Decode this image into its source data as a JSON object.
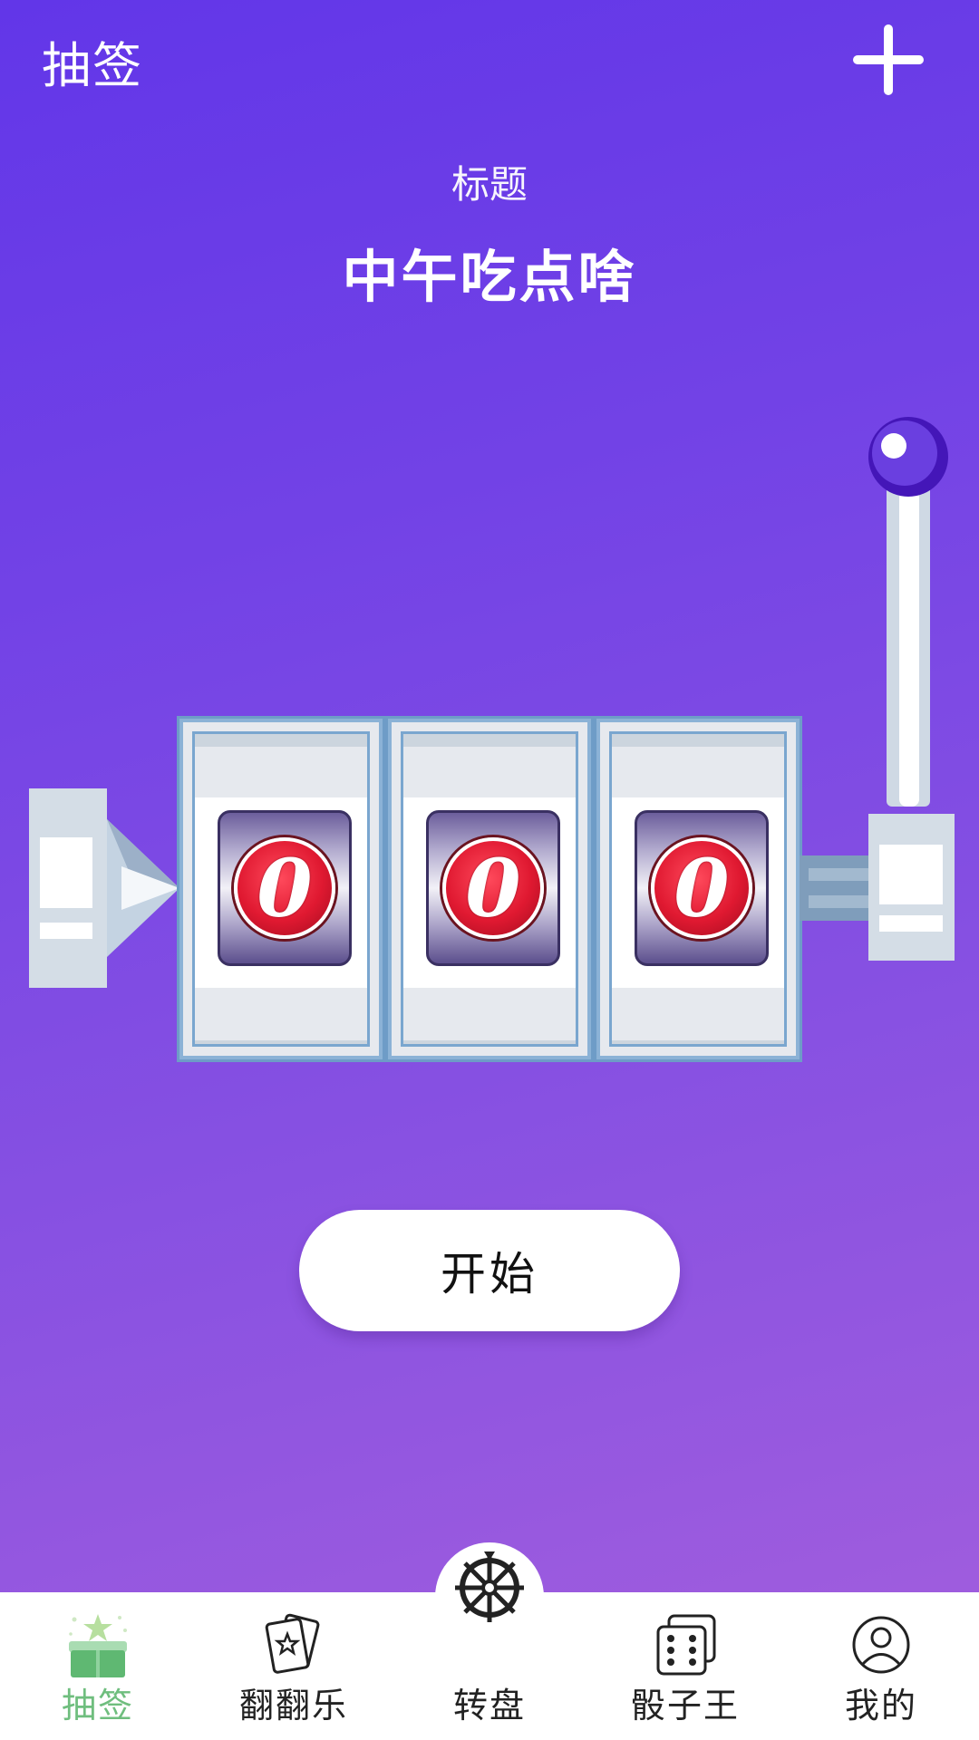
{
  "header": {
    "app_title": "抽签",
    "add_icon": "plus-icon"
  },
  "content": {
    "subtitle_label": "标题",
    "title": "中午吃点啥"
  },
  "slot_machine": {
    "reels": [
      "0",
      "0",
      "0"
    ],
    "lever_icon": "lever-knob-icon"
  },
  "start_button": {
    "label": "开始"
  },
  "tabbar": {
    "active_color": "#6fbe7e",
    "items": [
      {
        "label": "抽签",
        "icon": "lottery-box-icon",
        "active": true
      },
      {
        "label": "翻翻乐",
        "icon": "cards-icon",
        "active": false
      },
      {
        "label": "转盘",
        "icon": "wheel-icon",
        "active": false
      },
      {
        "label": "骰子王",
        "icon": "dice-icon",
        "active": false
      },
      {
        "label": "我的",
        "icon": "user-icon",
        "active": false
      }
    ]
  }
}
